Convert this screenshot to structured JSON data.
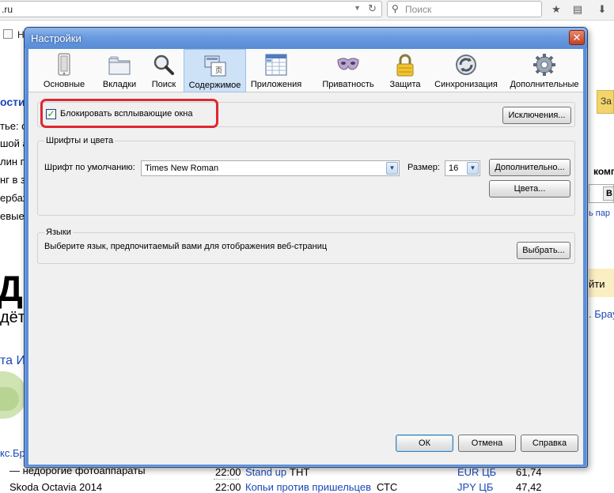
{
  "browser": {
    "url": ".ru",
    "search_placeholder": "Поиск",
    "bookmark_text": "Н"
  },
  "background_page": {
    "fragments_left": [
      "ости",
      "тье: с",
      "шой а",
      "лин п",
      "нг в з",
      "ербаж",
      "евые"
    ],
    "big_letter": "Д",
    "sub_fragment": "дёт",
    "link_fragment": "та И",
    "right_fragments": [
      "За",
      "комп",
      "В",
      "ь пар",
      "йти",
      ". Брау"
    ],
    "bottom_link_fragment": "кс.Бр",
    "rows": [
      {
        "left": "— недорогие фотоаппараты",
        "time": "22:00",
        "show": "Stand up",
        "channel": "ТНТ",
        "cur": "EUR ЦБ",
        "rate": "61,74"
      },
      {
        "left": "Skoda Octavia 2014",
        "time": "22:00",
        "show": "Копьи против пришельцев",
        "channel": "СТС",
        "cur": "JPY ЦБ",
        "rate": "47,42"
      }
    ]
  },
  "dialog": {
    "title": "Настройки",
    "close_glyph": "✕",
    "tabs": [
      {
        "label": "Основные",
        "icon": "general-icon"
      },
      {
        "label": "Вкладки",
        "icon": "tabs-icon"
      },
      {
        "label": "Поиск",
        "icon": "search-icon"
      },
      {
        "label": "Содержимое",
        "icon": "content-icon",
        "active": true
      },
      {
        "label": "Приложения",
        "icon": "applications-icon"
      },
      {
        "label": "Приватность",
        "icon": "privacy-mask-icon"
      },
      {
        "label": "Защита",
        "icon": "padlock-icon"
      },
      {
        "label": "Синхронизация",
        "icon": "sync-icon"
      },
      {
        "label": "Дополнительные",
        "icon": "gear-icon"
      }
    ],
    "popup": {
      "checkbox_label": "Блокировать всплывающие окна",
      "checked": true,
      "exceptions_button": "Исключения..."
    },
    "fonts": {
      "group_title": "Шрифты и цвета",
      "default_font_label": "Шрифт по умолчанию:",
      "default_font_value": "Times New Roman",
      "size_label": "Размер:",
      "size_value": "16",
      "advanced_button": "Дополнительно...",
      "colors_button": "Цвета..."
    },
    "languages": {
      "group_title": "Языки",
      "description": "Выберите язык, предпочитаемый вами для отображения веб-страниц",
      "choose_button": "Выбрать..."
    },
    "footer": {
      "ok": "ОК",
      "cancel": "Отмена",
      "help": "Справка"
    },
    "highlight_color": "#e0262e"
  }
}
